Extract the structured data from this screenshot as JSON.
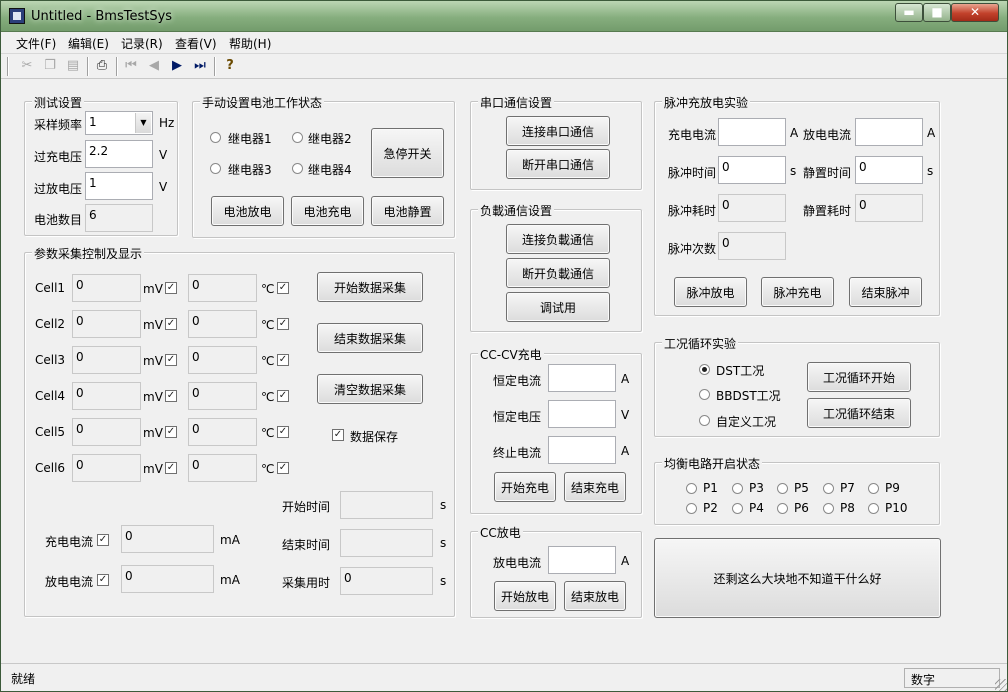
{
  "window": {
    "title": "Untitled - BmsTestSys",
    "minimize": "▬",
    "maximize": "■",
    "close": "✕"
  },
  "menu": [
    "文件(F)",
    "编辑(E)",
    "记录(R)",
    "查看(V)",
    "帮助(H)"
  ],
  "toolbar_icons": [
    "cut-icon",
    "copy-icon",
    "paste-icon",
    "print-icon",
    "first-record-icon",
    "prev-record-icon",
    "next-record-icon",
    "last-record-icon",
    "help-icon"
  ],
  "test_settings": {
    "title": "测试设置",
    "rate_label": "采样频率",
    "rate_value": "1",
    "rate_unit": "Hz",
    "overcharge_label": "过充电压",
    "overcharge_value": "2.2",
    "overcharge_unit": "V",
    "overdischarge_label": "过放电压",
    "overdischarge_value": "1",
    "overdischarge_unit": "V",
    "cell_count_label": "电池数目",
    "cell_count_value": "6"
  },
  "manual": {
    "title": "手动设置电池工作状态",
    "relay1": "继电器1",
    "relay2": "继电器2",
    "relay3": "继电器3",
    "relay4": "继电器4",
    "estop": "急停开关",
    "discharge": "电池放电",
    "charge": "电池充电",
    "rest": "电池静置"
  },
  "params": {
    "title": "参数采集控制及显示",
    "cells": [
      {
        "label": "Cell1",
        "voltage": "0",
        "temp": "0"
      },
      {
        "label": "Cell2",
        "voltage": "0",
        "temp": "0"
      },
      {
        "label": "Cell3",
        "voltage": "0",
        "temp": "0"
      },
      {
        "label": "Cell4",
        "voltage": "0",
        "temp": "0"
      },
      {
        "label": "Cell5",
        "voltage": "0",
        "temp": "0"
      },
      {
        "label": "Cell6",
        "voltage": "0",
        "temp": "0"
      }
    ],
    "mv_unit": "mV",
    "temp_unit": "℃",
    "start": "开始数据采集",
    "stop": "结束数据采集",
    "clear": "清空数据采集",
    "save": "数据保存",
    "start_time_label": "开始时间",
    "start_time_value": "",
    "end_time_label": "结束时间",
    "end_time_value": "",
    "elapsed_label": "采集用时",
    "elapsed_value": "0",
    "sec": "s",
    "charge_current_label": "充电电流",
    "charge_current_value": "0",
    "discharge_current_label": "放电电流",
    "discharge_current_value": "0",
    "ma_unit": "mA"
  },
  "serial": {
    "title": "串口通信设置",
    "connect": "连接串口通信",
    "disconnect": "断开串口通信"
  },
  "load": {
    "title": "负載通信设置",
    "connect": "连接负載通信",
    "disconnect": "断开负載通信",
    "test": "调试用"
  },
  "cccv": {
    "title": "CC-CV充电",
    "current_label": "恒定电流",
    "current_value": "",
    "current_unit": "A",
    "voltage_label": "恒定电压",
    "voltage_value": "",
    "voltage_unit": "V",
    "cutoff_label": "终止电流",
    "cutoff_value": "",
    "cutoff_unit": "A",
    "start": "开始充电",
    "stop": "结束充电"
  },
  "cc": {
    "title": "CC放电",
    "current_label": "放电电流",
    "current_value": "",
    "current_unit": "A",
    "start": "开始放电",
    "stop": "结束放电"
  },
  "pulse": {
    "title": "脉冲充放电实验",
    "charge_current_label": "充电电流",
    "charge_current_value": "",
    "discharge_current_label": "放电电流",
    "discharge_current_value": "",
    "a_unit": "A",
    "pulse_time_label": "脉冲时间",
    "pulse_time_value": "0",
    "rest_time_label": "静置时间",
    "rest_time_value": "0",
    "s_unit": "s",
    "pulse_elapsed_label": "脉冲耗时",
    "pulse_elapsed_value": "0",
    "rest_elapsed_label": "静置耗时",
    "rest_elapsed_value": "0",
    "count_label": "脉冲次数",
    "count_value": "0",
    "discharge": "脉冲放电",
    "charge": "脉冲充电",
    "stop": "结束脉冲"
  },
  "cycle": {
    "title": "工况循环实验",
    "dst": "DST工况",
    "bbdst": "BBDST工况",
    "custom": "自定义工况",
    "start": "工况循环开始",
    "stop": "工况循环结束"
  },
  "balance": {
    "title": "均衡电路开启状态",
    "row1": [
      "P1",
      "P3",
      "P5",
      "P7",
      "P9"
    ],
    "row2": [
      "P2",
      "P4",
      "P6",
      "P8",
      "P10"
    ]
  },
  "big_button": "还剩这么大块地不知道干什么好",
  "status": {
    "left": "就绪",
    "right": "数字"
  }
}
